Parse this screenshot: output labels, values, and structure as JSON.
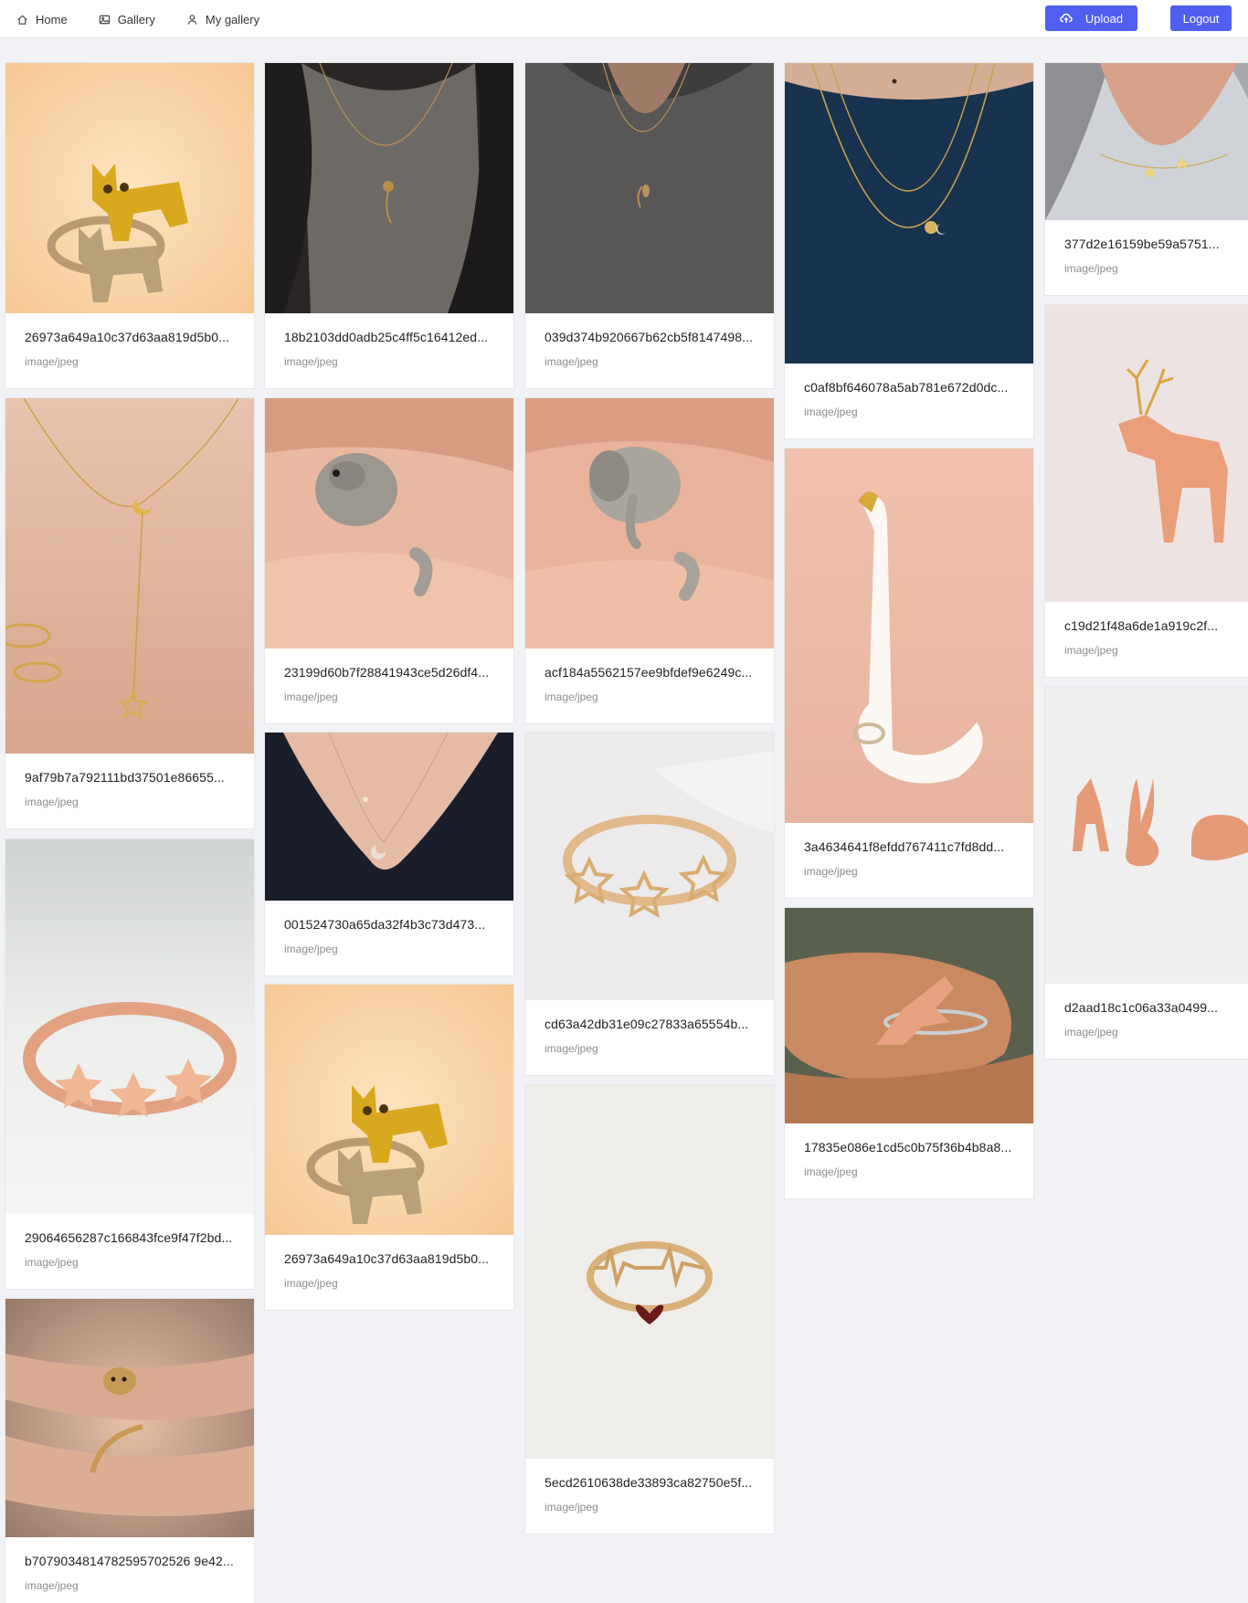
{
  "nav": {
    "home": "Home",
    "gallery": "Gallery",
    "my_gallery": "My gallery"
  },
  "actions": {
    "upload": "Upload",
    "logout": "Logout"
  },
  "colors": {
    "accent": "#4f5ff0",
    "page_bg": "#f0f2f5"
  },
  "items": [
    {
      "name": "26973a649a10c37d63aa819d5b0...",
      "type": "image/jpeg",
      "subject": "cat-ring"
    },
    {
      "name": "9af79b7a792111bd37501e86655...",
      "type": "image/jpeg",
      "subject": "moon-star-necklace"
    },
    {
      "name": "29064656287c166843fce9f47f2bd...",
      "type": "image/jpeg",
      "subject": "star-ring-rose"
    },
    {
      "name": "b7079034814782595702526 9e42...",
      "type": "image/jpeg",
      "subject": "kitten-ring"
    },
    {
      "name": "18b2103dd0adb25c4ff5c16412ed...",
      "type": "image/jpeg",
      "subject": "rose-necklace"
    },
    {
      "name": "23199d60b7f28841943ce5d26df4...",
      "type": "image/jpeg",
      "subject": "giraffe-ring"
    },
    {
      "name": "001524730a65da32f4b3c73d473...",
      "type": "image/jpeg",
      "subject": "moon-necklace"
    },
    {
      "name": "26973a649a10c37d63aa819d5b0...",
      "type": "image/jpeg",
      "subject": "cat-ring"
    },
    {
      "name": "039d374b920667b62cb5f8147498...",
      "type": "image/jpeg",
      "subject": "leaf-necklace"
    },
    {
      "name": "acf184a5562157ee9bfdef9e6249c...",
      "type": "image/jpeg",
      "subject": "elephant-ring"
    },
    {
      "name": "cd63a42db31e09c27833a65554b...",
      "type": "image/jpeg",
      "subject": "star-ring-gold"
    },
    {
      "name": "5ecd2610638de33893ca82750e5f...",
      "type": "image/jpeg",
      "subject": "heartbeat-ring"
    },
    {
      "name": "c0af8bf646078a5ab781e672d0dc...",
      "type": "image/jpeg",
      "subject": "layered-necklace"
    },
    {
      "name": "3a4634641f8efdd767411c7fd8dd...",
      "type": "image/jpeg",
      "subject": "swan-holder"
    },
    {
      "name": "17835e086e1cd5c0b75f36b4b8a8...",
      "type": "image/jpeg",
      "subject": "dinosaur-ring"
    },
    {
      "name": "377d2e16159be59a5751...",
      "type": "image/jpeg",
      "subject": "stars-necklace"
    },
    {
      "name": "c19d21f48a6de1a919c2f...",
      "type": "image/jpeg",
      "subject": "deer-figurine"
    },
    {
      "name": "d2aad18c1c06a33a0499...",
      "type": "image/jpeg",
      "subject": "animal-figurines"
    }
  ]
}
